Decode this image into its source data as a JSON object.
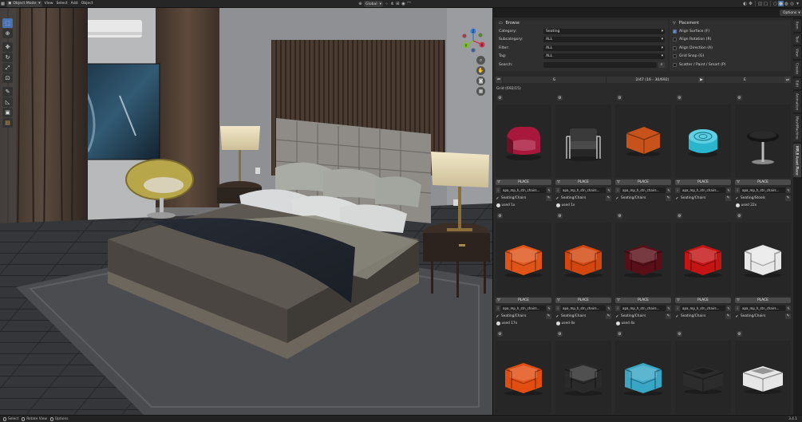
{
  "header": {
    "mode": "Object Mode",
    "menus": [
      "View",
      "Select",
      "Add",
      "Object"
    ],
    "orientation": "Global",
    "options": "Options"
  },
  "viewport": {
    "gizmo_axes": [
      "X",
      "Y",
      "Z"
    ]
  },
  "panel": {
    "browse": {
      "title": "Browse",
      "fields": [
        {
          "label": "Category:",
          "value": "Seating"
        },
        {
          "label": "Subcategory:",
          "value": "ALL"
        },
        {
          "label": "Filter:",
          "value": "ALL"
        },
        {
          "label": "Tag:",
          "value": "ALL"
        }
      ],
      "search_label": "Search:",
      "search_value": ""
    },
    "placement": {
      "title": "Placement",
      "options": [
        {
          "label": "Align Surface (F)",
          "checked": true
        },
        {
          "label": "Align Rotation (R)",
          "checked": false
        },
        {
          "label": "Align Direction (A)",
          "checked": false
        },
        {
          "label": "Grid Snap (G)",
          "checked": false
        },
        {
          "label": "Scatter / Paint / Smart (P)",
          "checked": false
        }
      ]
    },
    "pager": {
      "prev_label": "G",
      "page_info": "2/47 (16 - 30/692)",
      "next_label": "E"
    },
    "grid_label": "Grid (692/15)",
    "place_label": "PLACE",
    "items": [
      {
        "name": "apa_mp_h_stn_chairs...",
        "category": "Seating/Chairs",
        "used": "used 1x",
        "color": "#a8173c",
        "shape": "armchair-modern"
      },
      {
        "name": "apa_mp_h_stn_chairs...",
        "category": "Seating/Chairs",
        "used": "used 1x",
        "color": "#3a3a3a",
        "shape": "armchair-frame"
      },
      {
        "name": "apa_mp_h_stn_chairs...",
        "category": "Seating/Chairs",
        "used": "",
        "color": "#c8521b",
        "shape": "armchair-low"
      },
      {
        "name": "apa_mp_h_stn_chairs...",
        "category": "Seating/Chairs",
        "used": "",
        "color": "#2ab5cf",
        "shape": "pouf-round"
      },
      {
        "name": "apa_mp_h_stn_chairs...",
        "category": "Seating/Stools",
        "used": "used 22x",
        "color": "#151515",
        "shape": "stool"
      },
      {
        "name": "apa_mp_h_stn_chairs...",
        "category": "Seating/Chairs",
        "used": "used 17x",
        "color": "#e0541a",
        "shape": "armchair-box"
      },
      {
        "name": "apa_mp_h_stn_chairs...",
        "category": "Seating/Chairs",
        "used": "used 4x",
        "color": "#d3470f",
        "shape": "armchair-box"
      },
      {
        "name": "apa_mp_h_stn_chairs...",
        "category": "Seating/Chairs",
        "used": "used 4x",
        "color": "#5a0f18",
        "shape": "armchair-box"
      },
      {
        "name": "apa_mp_h_stn_chairs...",
        "category": "Seating/Chairs",
        "used": "",
        "color": "#c41414",
        "shape": "armchair-box"
      },
      {
        "name": "apa_mp_h_stn_chairs...",
        "category": "Seating/Chairs",
        "used": "",
        "color": "#e8e8e8",
        "shape": "armchair-box"
      },
      {
        "name": "",
        "category": "",
        "used": "",
        "color": "#e24e12",
        "shape": "armchair-box"
      },
      {
        "name": "",
        "category": "",
        "used": "",
        "color": "#2a2a2a",
        "shape": "armchair-box"
      },
      {
        "name": "",
        "category": "",
        "used": "",
        "color": "#3aa6c6",
        "shape": "armchair-box"
      },
      {
        "name": "",
        "category": "",
        "used": "",
        "color": "#2c2c2c",
        "shape": "ottoman"
      },
      {
        "name": "",
        "category": "",
        "used": "",
        "color": "#e6e6e6",
        "shape": "ottoman"
      }
    ]
  },
  "side_tabs": [
    "Item",
    "Tool",
    "View",
    "Create",
    "Edit",
    "Animation",
    "MeshMachine",
    "MPLB Asset Place"
  ],
  "status": {
    "items": [
      "Select",
      "Rotate View",
      "Options"
    ],
    "version": "3.4.1"
  },
  "colors": {
    "accent": "#4772b3",
    "panel_bg": "#2a2a2a",
    "header_bg": "#262626"
  }
}
